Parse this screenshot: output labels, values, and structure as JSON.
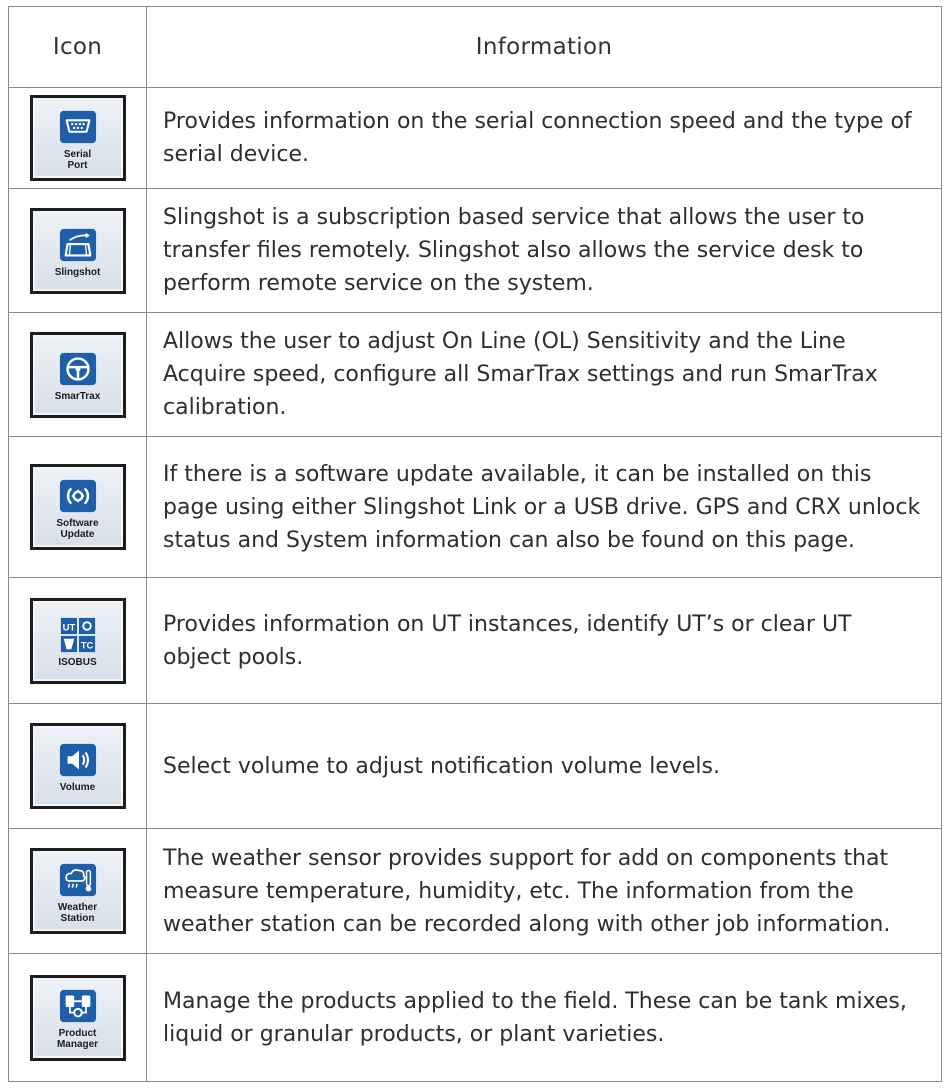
{
  "table": {
    "headers": {
      "icon": "Icon",
      "information": "Information"
    },
    "rows": [
      {
        "icon_name": "serial-port-icon",
        "icon_label": "Serial\nPort",
        "description": "Provides information on the serial connection speed and the type of serial device."
      },
      {
        "icon_name": "slingshot-icon",
        "icon_label": "Slingshot",
        "description": "Slingshot is a subscription based service that allows the user to transfer files remotely. Slingshot also allows the service desk to perform remote service on the system."
      },
      {
        "icon_name": "smartrax-icon",
        "icon_label": "SmarTrax",
        "description": "Allows the user to adjust On Line (OL) Sensitivity and the Line Acquire speed, configure all SmarTrax settings and run SmarTrax calibration."
      },
      {
        "icon_name": "software-update-icon",
        "icon_label": "Software\nUpdate",
        "description": "If there is a software update available, it can be installed on this page using either Slingshot Link or a USB drive. GPS and CRX unlock status and System information can also be found on this page."
      },
      {
        "icon_name": "isobus-icon",
        "icon_label": "ISOBUS",
        "description": "Provides information on UT instances, identify UT’s or clear UT object pools."
      },
      {
        "icon_name": "volume-icon",
        "icon_label": "Volume",
        "description": "Select volume to adjust notification volume levels."
      },
      {
        "icon_name": "weather-station-icon",
        "icon_label": "Weather\nStation",
        "description": "The weather sensor provides support for add on components that measure temperature, humidity, etc. The information from the weather station can be recorded along with other job information."
      },
      {
        "icon_name": "product-manager-icon",
        "icon_label": "Product\nManager",
        "description": "Manage the products applied to the field. These can be tank mixes, liquid or granular products, or plant varieties."
      }
    ]
  },
  "colors": {
    "icon_blue": "#1f5fa8",
    "icon_bg": "#e3e9f1",
    "border": "#8a8a8a"
  }
}
